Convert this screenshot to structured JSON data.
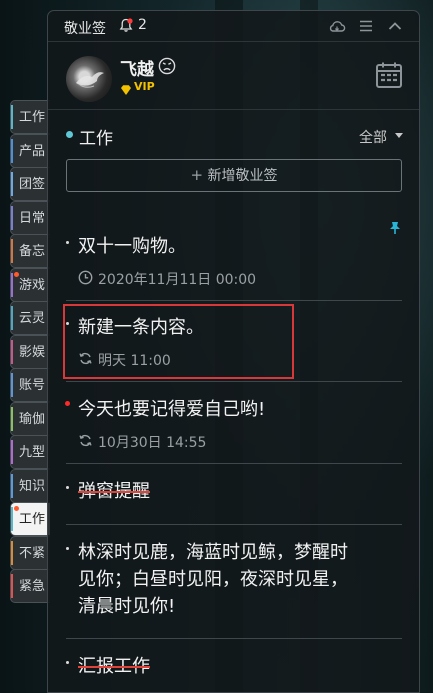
{
  "app": {
    "title": "敬业签",
    "notification_count": "2"
  },
  "user": {
    "name": "飞越",
    "badge": "VIP"
  },
  "side_tabs": [
    {
      "label": "工作",
      "color": "#58b7c9",
      "dot": false
    },
    {
      "label": "产品",
      "color": "#4f8fd9",
      "dot": false
    },
    {
      "label": "团签",
      "color": "#6ea9e6",
      "dot": false
    },
    {
      "label": "日常",
      "color": "#7b7fd1",
      "dot": false
    },
    {
      "label": "备忘",
      "color": "#d4763f",
      "dot": false
    },
    {
      "label": "游戏",
      "color": "#9b6fd0",
      "dot": true
    },
    {
      "label": "云灵",
      "color": "#4ea8c0",
      "dot": false
    },
    {
      "label": "影娱",
      "color": "#c45a8b",
      "dot": false
    },
    {
      "label": "账号",
      "color": "#5d95d6",
      "dot": false
    },
    {
      "label": "瑜伽",
      "color": "#8ac060",
      "dot": false
    },
    {
      "label": "九型",
      "color": "#b06ad2",
      "dot": false
    },
    {
      "label": "知识",
      "color": "#5a9be0",
      "dot": false
    },
    {
      "label": "工作",
      "color": "#58b7c9",
      "dot": true,
      "active": true
    },
    {
      "label": "不紧",
      "color": "#d88b3b",
      "dot": false
    },
    {
      "label": "紧急",
      "color": "#e05252",
      "dot": false
    }
  ],
  "category": {
    "name": "工作",
    "filter": "全部",
    "accent": "#5fc7d5"
  },
  "add_button": {
    "label": "新增敬业签"
  },
  "notes": [
    {
      "text": "双十一购物。",
      "meta": "2020年11月11日 00:00",
      "icon": "clock-icon"
    },
    {
      "text": "新建一条内容。",
      "meta": "明天 11:00",
      "icon": "repeat-icon"
    },
    {
      "text": "今天也要记得爱自己哟!",
      "meta": "10月30日 14:55",
      "icon": "repeat-icon"
    },
    {
      "text": "弹窗提醒",
      "done": true
    },
    {
      "text_lines": [
        "林深时见鹿，海蓝时见鲸，梦醒时",
        "见你；白昼时见阳，夜深时见星，",
        "清晨时见你!"
      ]
    },
    {
      "text": "汇报工作",
      "done": true
    }
  ],
  "colors": {
    "highlight": "#d9383a",
    "strike": "#e0433a",
    "vip": "#f2c200",
    "pin": "#29b6d6"
  }
}
